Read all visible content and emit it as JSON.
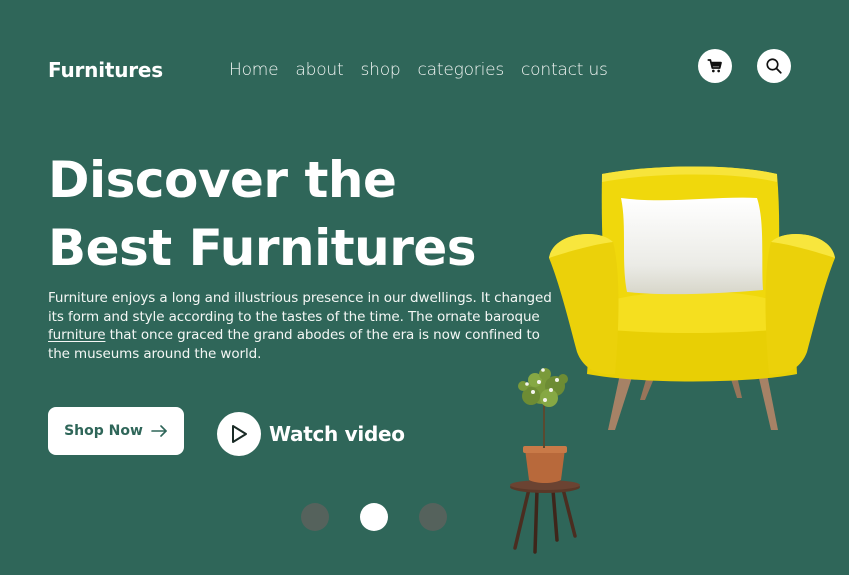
{
  "brand": "Furnitures",
  "nav": [
    "Home",
    "about",
    "shop",
    "categories",
    "contact us"
  ],
  "header_icons": [
    "cart-icon",
    "search-icon"
  ],
  "hero": {
    "headline_line1": "Discover the",
    "headline_line2": "Best Furnitures",
    "description_part1": "Furniture enjoys a long and illustrious presence in our dwellings. It changed its form and style according to the tastes of the time. The ornate baroque ",
    "description_link": "furniture",
    "description_part2": " that once graced the grand abodes of the era is now confined to the museums around the world.",
    "shop_button": "Shop Now",
    "watch_label": "Watch video"
  },
  "carousel": {
    "total": 3,
    "active": 2
  },
  "colors": {
    "background": "#2f6659",
    "chair": "#f2dc0c",
    "text": "#ffffff",
    "dot_inactive": "#55625c"
  }
}
